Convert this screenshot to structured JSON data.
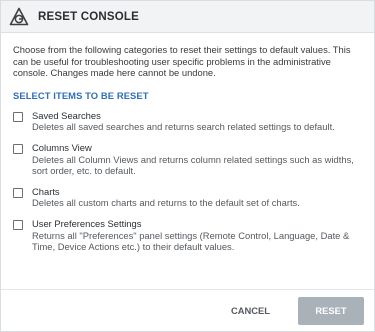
{
  "dialog": {
    "title": "RESET CONSOLE",
    "logo_icon": "logo-icon",
    "description": "Choose from the following categories to reset their settings to default values. This can be useful for troubleshooting user specific problems in the administrative console. Changes made here cannot be undone.",
    "section_title": "SELECT ITEMS TO BE RESET",
    "options": [
      {
        "title": "Saved Searches",
        "description": "Deletes all saved searches and returns search related settings to default.",
        "checked": false
      },
      {
        "title": "Columns View",
        "description": "Deletes all Column Views and returns column related settings such as widths, sort order, etc. to default.",
        "checked": false
      },
      {
        "title": "Charts",
        "description": "Deletes all custom charts and returns to the default set of charts.",
        "checked": false
      },
      {
        "title": "User Preferences Settings",
        "description": "Returns all \"Preferences\" panel settings (Remote Control, Language, Date & Time, Device Actions etc.) to their default values.",
        "checked": false
      }
    ],
    "buttons": {
      "cancel": "CANCEL",
      "reset": "RESET"
    },
    "colors": {
      "accent": "#2f6fb7",
      "header_bg": "#f1f3f5",
      "reset_disabled": "#a9b1b9"
    }
  }
}
